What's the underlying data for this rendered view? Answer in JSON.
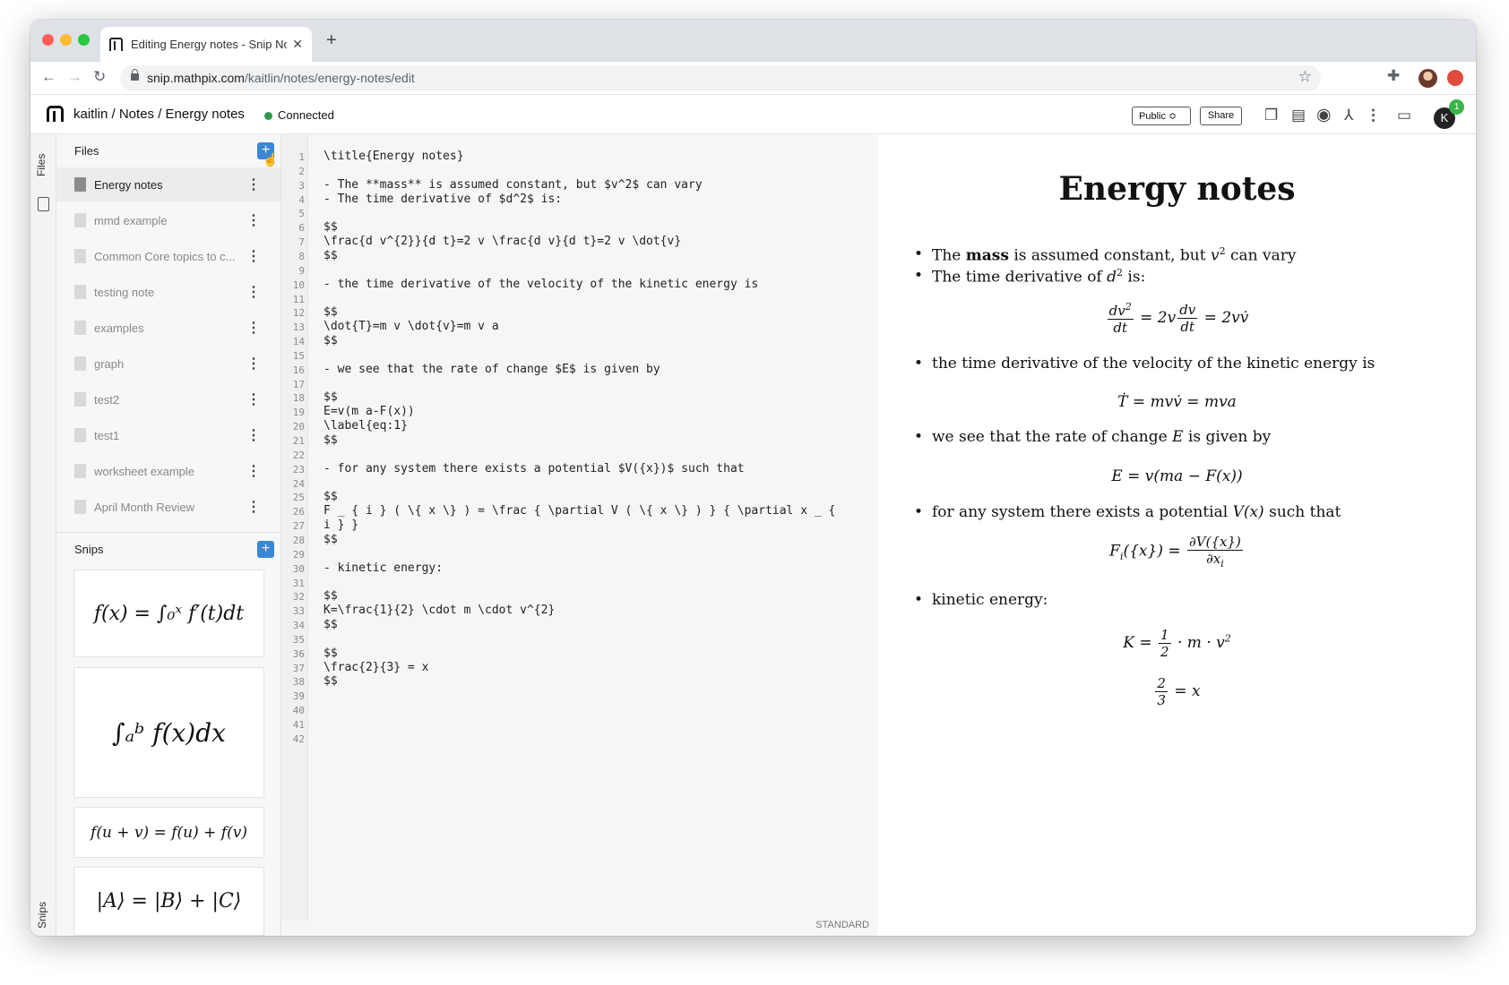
{
  "browser": {
    "tab_title": "Editing Energy notes - Snip Notes",
    "url_host": "snip.mathpix.com",
    "url_path": "/kaitlin/notes/energy-notes/edit"
  },
  "header": {
    "breadcrumb": "kaitlin / Notes / Energy notes",
    "status": "Connected",
    "public_label": "Public ≎",
    "share_label": "Share",
    "avatar_letter": "K",
    "notification_count": "1"
  },
  "rail": {
    "files_label": "Files",
    "snips_label": "Snips"
  },
  "sidebar": {
    "files_title": "Files",
    "snips_title": "Snips",
    "files": [
      "Energy notes",
      "mmd example",
      "Common Core topics to c...",
      "testing note",
      "examples",
      "graph",
      "test2",
      "test1",
      "worksheet example",
      "April Month Review"
    ],
    "snips": [
      "f(x) = ∫₀ˣ f′(t)dt",
      "∫ₐᵇ f(x)dx",
      "f(u + v) = f(u) + f(v)",
      "|A⟩ = |B⟩ + |C⟩"
    ]
  },
  "editor": {
    "mode": "STANDARD",
    "lines": [
      "\\title{Energy notes}",
      "",
      "- The **mass** is assumed constant, but $v^2$ can vary",
      "- The time derivative of $d^2$ is:",
      "",
      "$$",
      "\\frac{d v^{2}}{d t}=2 v \\frac{d v}{d t}=2 v \\dot{v}",
      "$$",
      "",
      "- the time derivative of the velocity of the kinetic energy is",
      "",
      "$$",
      "\\dot{T}=m v \\dot{v}=m v a",
      "$$",
      "",
      "- we see that the rate of change $E$ is given by",
      "",
      "$$",
      "E=v(m a-F(x))",
      "\\label{eq:1}",
      "$$",
      "",
      "- for any system there exists a potential $V({x})$ such that",
      "",
      "$$",
      "F _ { i } ( \\{ x \\} ) = \\frac { \\partial V ( \\{ x \\} ) } { \\partial x _ {",
      "i } }",
      "$$",
      "",
      "- kinetic energy:",
      "",
      "$$",
      "K=\\frac{1}{2} \\cdot m \\cdot v^{2}",
      "$$",
      "",
      "$$",
      "\\frac{2}{3} = x",
      "$$",
      "",
      "",
      "",
      ""
    ]
  },
  "preview": {
    "title": "Energy notes",
    "b1_pre": "The ",
    "b1_bold": "mass",
    "b1_mid": " is assumed constant, but ",
    "b1_var": "v",
    "b1_post": " can vary",
    "b2_pre": "The time derivative of ",
    "b2_var": "d",
    "b2_post": " is:",
    "b3": "the time derivative of the velocity of the kinetic energy is",
    "b4_pre": "we see that the rate of change ",
    "b4_var": "E",
    "b4_post": " is given by",
    "b5_pre": "for any system there exists a potential ",
    "b5_var": "V(x)",
    "b5_post": " such that",
    "b6": "kinetic energy:",
    "eq2": "Ṫ = mvv̇ = mva",
    "eq3": "E = v(ma − F(x))"
  }
}
